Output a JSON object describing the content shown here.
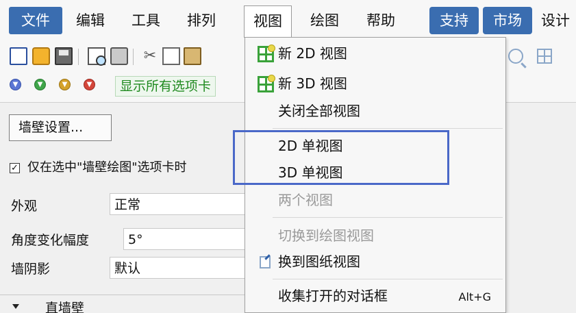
{
  "menubar": {
    "items": [
      {
        "label": "文件"
      },
      {
        "label": "编辑"
      },
      {
        "label": "工具"
      },
      {
        "label": "排列"
      },
      {
        "label": "视图"
      },
      {
        "label": "绘图"
      },
      {
        "label": "帮助"
      },
      {
        "label": "支持"
      },
      {
        "label": "市场"
      },
      {
        "label": "设计"
      }
    ]
  },
  "toolbar2": {
    "show_all_tabs": "显示所有选项卡"
  },
  "panel": {
    "wall_settings_button": "墙壁设置...",
    "checkbox_label": "仅在选中\"墙壁绘图\"选项卡时",
    "checkbox_checked": "✓",
    "properties": [
      {
        "label": "外观",
        "value": "正常"
      },
      {
        "label": "角度变化幅度",
        "value": "5°"
      },
      {
        "label": "墙阴影",
        "value": "默认"
      }
    ],
    "section_label": "直墙壁"
  },
  "view_menu": {
    "items": [
      {
        "label": "新 2D 视图",
        "icon": "new-view-icon",
        "enabled": true
      },
      {
        "label": "新 3D 视图",
        "icon": "new-view-icon",
        "enabled": true
      },
      {
        "label": "关闭全部视图",
        "enabled": true
      },
      {
        "label": "2D 单视图",
        "enabled": true
      },
      {
        "label": "3D 单视图",
        "enabled": true
      },
      {
        "label": "两个视图",
        "enabled": false
      },
      {
        "label": "切换到绘图视图",
        "enabled": false
      },
      {
        "label": "换到图纸视图",
        "icon": "sheet-view-icon",
        "enabled": true
      },
      {
        "label": "收集打开的对话框",
        "shortcut": "Alt+G",
        "enabled": true
      }
    ]
  },
  "colors": {
    "accent": "#3a6db0",
    "highlight_box": "#4a68c8",
    "show_tabs_text": "#1f8a1f",
    "disabled_text": "#9a9a9a"
  }
}
